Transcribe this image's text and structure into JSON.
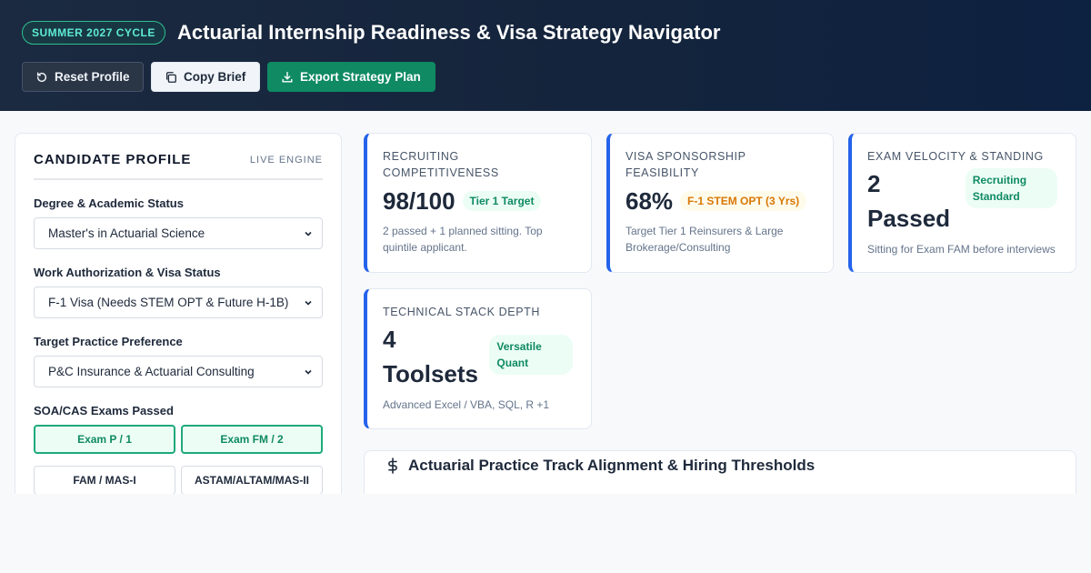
{
  "header": {
    "cycle_badge": "SUMMER 2027 CYCLE",
    "title": "Actuarial Internship Readiness & Visa Strategy Navigator",
    "buttons": {
      "reset": "Reset Profile",
      "copy": "Copy Brief",
      "export": "Export Strategy Plan"
    }
  },
  "profile": {
    "title": "CANDIDATE PROFILE",
    "engine": "LIVE ENGINE",
    "degree": {
      "label": "Degree & Academic Status",
      "value": "Master's in Actuarial Science"
    },
    "visa": {
      "label": "Work Authorization & Visa Status",
      "value": "F-1 Visa (Needs STEM OPT & Future H-1B)"
    },
    "practice": {
      "label": "Target Practice Preference",
      "value": "P&C Insurance & Actuarial Consulting"
    },
    "exams": {
      "label": "SOA/CAS Exams Passed",
      "items": [
        {
          "label": "Exam P / 1",
          "selected": true
        },
        {
          "label": "Exam FM / 2",
          "selected": true
        },
        {
          "label": "FAM / MAS-I",
          "selected": false
        },
        {
          "label": "ASTAM/ALTAM/MAS-II",
          "selected": false
        }
      ]
    }
  },
  "metrics": [
    {
      "label": "RECRUITING COMPETITIVENESS",
      "value": "98/100",
      "badge": "Tier 1 Target",
      "note": "2 passed + 1 planned sitting. Top quintile applicant."
    },
    {
      "label": "VISA SPONSORSHIP FEASIBILITY",
      "value": "68%",
      "badge": "F-1 STEM OPT (3 Yrs)",
      "note": "Target Tier 1 Reinsurers & Large Brokerage/Consulting"
    },
    {
      "label": "EXAM VELOCITY & STANDING",
      "value": "2 Passed",
      "badge": "Recruiting Standard",
      "note": "Sitting for Exam FAM before interviews"
    },
    {
      "label": "TECHNICAL STACK DEPTH",
      "value": "4 Toolsets",
      "badge": "Versatile Quant",
      "note": "Advanced Excel / VBA, SQL, R +1"
    }
  ],
  "track": {
    "title": "Actuarial Practice Track Alignment & Hiring Thresholds"
  },
  "colors": {
    "accent_blue": "#2563eb",
    "brand_green": "#0f8a63",
    "amber": "#d97706",
    "header_bg": "#14243c"
  }
}
